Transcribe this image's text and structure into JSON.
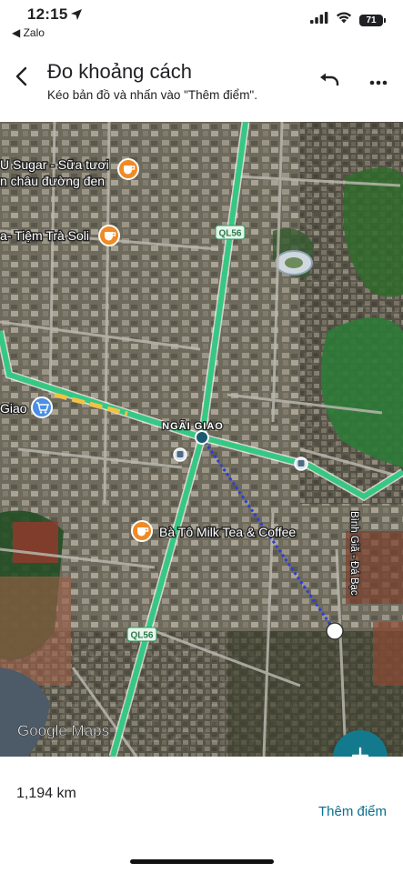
{
  "status_bar": {
    "time": "12:15",
    "back_app": "◀ Zalo",
    "battery": "71"
  },
  "header": {
    "title": "Đo khoảng cách",
    "subtitle": "Kéo bản đồ và nhấn vào \"Thêm điểm\"."
  },
  "map": {
    "places": [
      {
        "name_line1": "U Sugar - Sữa tươi",
        "name_line2": "n châu đường đen",
        "icon": "coffee-cup-icon"
      },
      {
        "name": "a- Tiệm Trà Soli",
        "icon": "coffee-cup-icon"
      },
      {
        "name": "Giao",
        "icon": "shopping-cart-icon"
      },
      {
        "name": "Bà Tô Milk Tea & Coffee",
        "icon": "coffee-cup-icon"
      }
    ],
    "town_label": "NGÃI GIAO",
    "road_shields": [
      "QL56",
      "QL56"
    ],
    "street_label": "Bình Giã - Đá Bạc",
    "google_logo": "Google Maps",
    "colors": {
      "road": "#36c882",
      "measure_line": "#2b3fd9",
      "poi_orange": "#f08a24",
      "poi_blue": "#4a8fe6"
    }
  },
  "bottom": {
    "distance": "1,194 km",
    "add_point": "Thêm điểm"
  }
}
